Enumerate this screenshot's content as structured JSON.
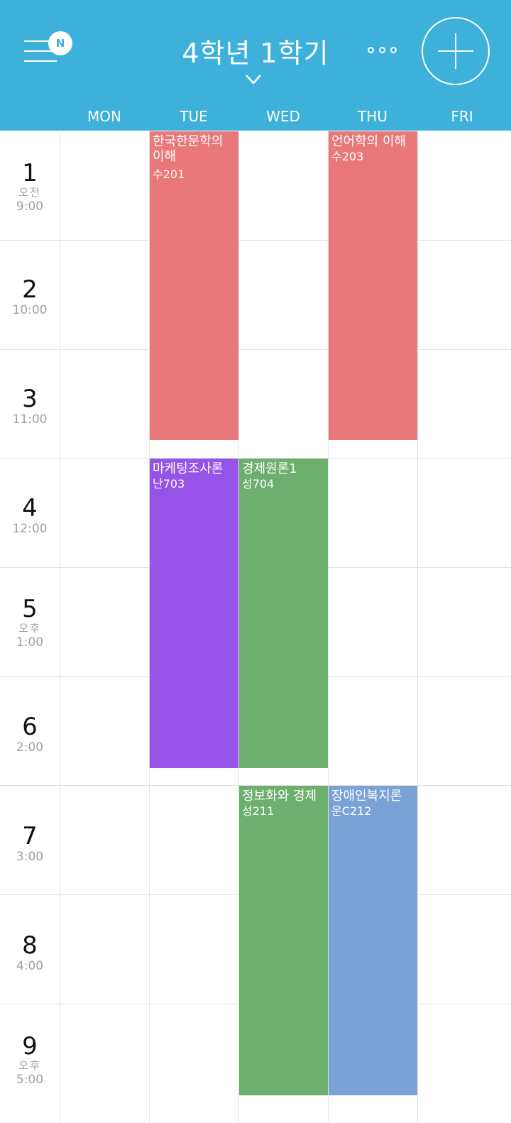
{
  "header": {
    "title": "4학년 1학기",
    "badge": "N",
    "menu_icon": "hamburger-icon",
    "more_icon": "more-dots-icon",
    "add_icon": "plus-icon",
    "dropdown_icon": "chevron-down-icon"
  },
  "days": [
    "MON",
    "TUE",
    "WED",
    "THU",
    "FRI"
  ],
  "periods": [
    {
      "num": "1",
      "ampm": "오전",
      "time": "9:00"
    },
    {
      "num": "2",
      "ampm": "",
      "time": "10:00"
    },
    {
      "num": "3",
      "ampm": "",
      "time": "11:00"
    },
    {
      "num": "4",
      "ampm": "",
      "time": "12:00"
    },
    {
      "num": "5",
      "ampm": "오후",
      "time": "1:00"
    },
    {
      "num": "6",
      "ampm": "",
      "time": "2:00"
    },
    {
      "num": "7",
      "ampm": "",
      "time": "3:00"
    },
    {
      "num": "8",
      "ampm": "",
      "time": "4:00"
    },
    {
      "num": "9",
      "ampm": "오후",
      "time": "5:00"
    }
  ],
  "classes": [
    {
      "name": "한국한문학의 이해",
      "room": "수201",
      "color": "#e8787a"
    },
    {
      "name": "언어학의 이해",
      "room": "수203",
      "color": "#e8787a"
    },
    {
      "name": "마케팅조사론",
      "room": "난703",
      "color": "#9553e8"
    },
    {
      "name": "경제원론1",
      "room": "성704",
      "color": "#6daf6e"
    },
    {
      "name": "정보화와 경제",
      "room": "성211",
      "color": "#6daf6e"
    },
    {
      "name": "장애인복지론",
      "room": "운C212",
      "color": "#7ba2d6"
    }
  ],
  "colors": {
    "header": "#3db1d9",
    "grid_line": "#e2e2e2",
    "muted_text": "#a0a0a0"
  }
}
